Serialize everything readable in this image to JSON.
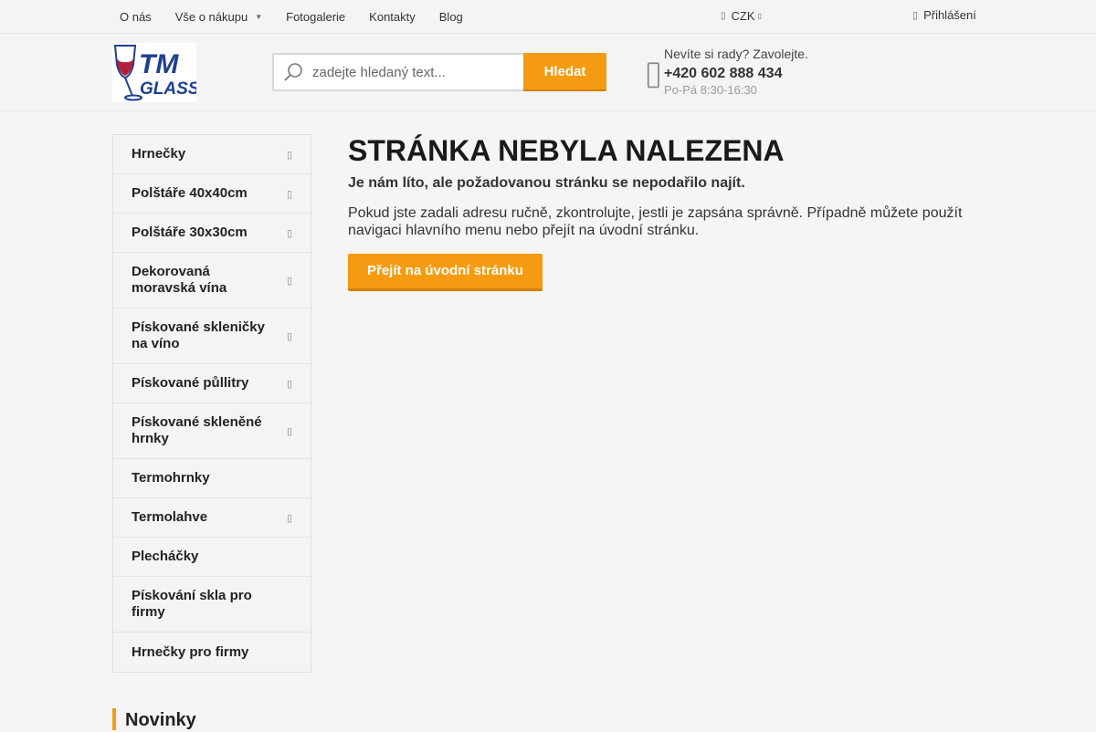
{
  "topnav": {
    "items": [
      {
        "label": "O nás"
      },
      {
        "label": "Vše o nákupu",
        "dropdown": true
      },
      {
        "label": "Fotogalerie"
      },
      {
        "label": "Kontakty"
      },
      {
        "label": "Blog"
      }
    ],
    "currency": "CZK",
    "login": "Přihlášení"
  },
  "header": {
    "logo_text_top": "TM",
    "logo_text_bottom": "GLASS",
    "search_placeholder": "zadejte hledaný text...",
    "search_button": "Hledat",
    "contact_question": "Nevíte si rady? Zavolejte.",
    "contact_phone": "+420 602 888 434",
    "contact_hours": "Po-Pá 8:30-16:30"
  },
  "sidebar": {
    "items": [
      {
        "label": "Hrnečky",
        "arrow": true
      },
      {
        "label": "Polštáře 40x40cm",
        "arrow": true
      },
      {
        "label": "Polštáře 30x30cm",
        "arrow": true
      },
      {
        "label": "Dekorovaná moravská vína",
        "arrow": true
      },
      {
        "label": "Pískované skleničky na víno",
        "arrow": true
      },
      {
        "label": "Pískované půllitry",
        "arrow": true
      },
      {
        "label": "Pískované skleněné hrnky",
        "arrow": true
      },
      {
        "label": "Termohrnky",
        "arrow": false
      },
      {
        "label": "Termolahve",
        "arrow": true
      },
      {
        "label": "Plecháčky",
        "arrow": false
      },
      {
        "label": "Pískování skla pro firmy",
        "arrow": false
      },
      {
        "label": "Hrnečky pro firmy",
        "arrow": false
      }
    ]
  },
  "main": {
    "title": "STRÁNKA NEBYLA NALEZENA",
    "lead": "Je nám líto, ale požadovanou stránku se nepodařilo najít.",
    "text": "Pokud jste zadali adresu ručně, zkontrolujte, jestli je zapsána správně. Případně můžete použít navigaci hlavního menu nebo přejít na úvodní stránku.",
    "home_button": "Přejít na úvodní stránku"
  },
  "novinky": {
    "title": "Novinky"
  },
  "colors": {
    "accent": "#f59b11",
    "logo_blue": "#1f3f8f",
    "logo_red": "#b3203c"
  }
}
